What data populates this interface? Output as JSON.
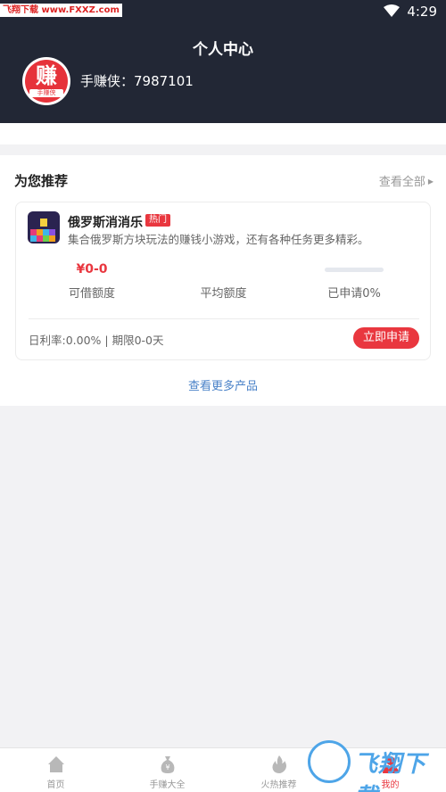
{
  "status_bar": {
    "watermark": "飞翔下载 www.FXXZ.com",
    "time": "4:29"
  },
  "header": {
    "title": "个人中心",
    "avatar_big": "赚",
    "avatar_small": "手赚侠",
    "username": "手赚侠：7987101"
  },
  "recommend": {
    "title": "为您推荐",
    "view_all": "查看全部",
    "product": {
      "name": "俄罗斯消消乐",
      "badge": "热门",
      "description": "集合俄罗斯方块玩法的赚钱小游戏，还有各种任务更多精彩。",
      "amount_value": "¥0-0",
      "amount_label": "可借额度",
      "average_label": "平均额度",
      "applied_label": "已申请0%",
      "applied_progress": 0,
      "footer": "日利率:0.00% | 期限0-0天",
      "apply_label": "立即申请"
    },
    "more": "查看更多产品"
  },
  "bottom_nav": [
    {
      "label": "首页",
      "icon": "home-icon"
    },
    {
      "label": "手赚大全",
      "icon": "money-bag-icon"
    },
    {
      "label": "火热推荐",
      "icon": "fire-icon"
    },
    {
      "label": "我的",
      "icon": "user-icon"
    }
  ],
  "logo_watermark": "飞翔下载",
  "colors": {
    "header_bg": "#222735",
    "accent_red": "#e9373f",
    "link_blue": "#4a82c8"
  }
}
